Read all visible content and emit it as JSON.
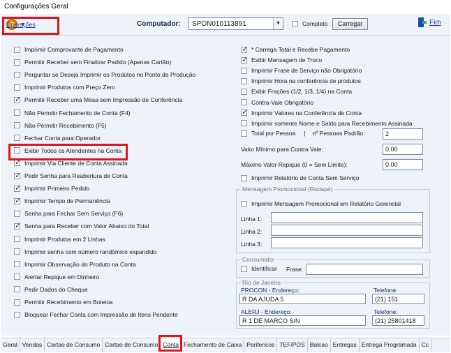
{
  "window": {
    "title": "Configurações Geral"
  },
  "toolbar": {
    "operations_label": "Operações",
    "computer_label": "Computador:",
    "computer_value": "SPON010113891",
    "complete_label": "Completo",
    "load_label": "Carregar",
    "exit_label": "Fim"
  },
  "left_options": [
    {
      "label": "Imprimir Comprovante de Pagamento",
      "checked": false
    },
    {
      "label": "Permitir Receber sem Finalizar Pedido (Apenas Cartão)",
      "checked": false
    },
    {
      "label": "Perguntar se Deseja Imprimir os Produtos no Ponto de Produção",
      "checked": false
    },
    {
      "label": "Imprimir Produtos com Preço Zero",
      "checked": false
    },
    {
      "label": "Permitir Receber uma Mesa sem Impressão de Conferência",
      "checked": true
    },
    {
      "label": "Não Permitir Fechamento de Conta (F4)",
      "checked": false
    },
    {
      "label": "Não Permitir Recebimento (F5)",
      "checked": false
    },
    {
      "label": "Fechar Conta para Operador",
      "checked": false
    },
    {
      "label": "Exibir Todos os Atendentes na Conta",
      "checked": false
    },
    {
      "label": "Imprimir Via Cliente de Conta Assinada",
      "checked": true
    },
    {
      "label": "Pedir Senha para Reabertura de Conta",
      "checked": true
    },
    {
      "label": "Imprimir Primeiro Pedido",
      "checked": true
    },
    {
      "label": "Imprimir Tempo de Permanência",
      "checked": true
    },
    {
      "label": "Senha para Fechar Sem Serviço (F6)",
      "checked": false
    },
    {
      "label": "Senha para Receber com Valor Abaixo do Total",
      "checked": true
    },
    {
      "label": "Imprimir Produtos em 2 Linhas",
      "checked": false
    },
    {
      "label": "Imprimir senha com número randômico expandido",
      "checked": false
    },
    {
      "label": "Imprimir Observação do Produto na Conta",
      "checked": false
    },
    {
      "label": "Alertar Repique em Dinheiro",
      "checked": false
    },
    {
      "label": "Pedir Dados do Cheque",
      "checked": false
    },
    {
      "label": "Permitir Recebimento em Boletos",
      "checked": false
    },
    {
      "label": "Bloquear Fechar Conta com Impressão de Itens Pendente",
      "checked": false
    }
  ],
  "right_options": [
    {
      "label": "* Carrega Total e Recebe Pagamento",
      "checked": true
    },
    {
      "label": "Exibir Mensagem de Troco",
      "checked": true
    },
    {
      "label": "Imprimir Frase de Serviço não Obrigatório",
      "checked": false
    },
    {
      "label": "Imprimir Hora na conferência de produtos",
      "checked": false
    },
    {
      "label": "Exibir Frações (1/2, 1/3, 1/4) na Conta",
      "checked": false
    },
    {
      "label": "Contra-Vale Obrigatório",
      "checked": false
    },
    {
      "label": "Imprimir Valores na Conferência de Conta",
      "checked": true
    },
    {
      "label": "Imprimir somente Nome e Saldo para Recebimento Assinada",
      "checked": false
    }
  ],
  "total_pessoa": {
    "label": "Total por Pessoa",
    "sep": "|",
    "count_label": "nº Pessoas Padrão:",
    "count_value": "2",
    "checked": false
  },
  "min_voucher": {
    "label": "Valor Mínimo para Contra Vale:",
    "value": "0.00"
  },
  "max_tip": {
    "label": "Máximo Valor Repique (0 = Sem Limite):",
    "value": "0.00"
  },
  "print_report": {
    "label": "Imprimir Relatório de Conta Sem Serviço",
    "checked": false
  },
  "promo": {
    "title": "Mensagem Promocional (Rodapé)",
    "print_label": "Imprimir Mensagem Promocional em Relatório Gerencial",
    "print_checked": false,
    "line1_label": "Linha 1:",
    "line1_value": "",
    "line2_label": "Linha 2:",
    "line2_value": "",
    "line3_label": "Linha 3:",
    "line3_value": ""
  },
  "consumer": {
    "title": "Consumidor",
    "identify_label": "Identificar",
    "identify_checked": false,
    "phrase_label": "Frase:",
    "phrase_value": ""
  },
  "rj": {
    "title": "Rio de Janeiro",
    "procon_label": "PROCON - Endereço:",
    "procon_value": "R DA AJUDA 5",
    "procon_phone_label": "Telefone:",
    "procon_phone_value": "(21) 151",
    "alerj_label": "ALERJ - Endereço:",
    "alerj_value": "R 1 DE MARCO S/N",
    "alerj_phone_label": "Telefone:",
    "alerj_phone_value": "(21) 25801418"
  },
  "tabs": [
    "Geral",
    "Vendas",
    "Cartao de Consumo",
    "Cartao de Consumo",
    "Conta",
    "Fechamento de Caixa",
    "Perifericos",
    "TEF/POS",
    "Balcao",
    "Entregas",
    "Entrega Programada",
    "Cc"
  ],
  "active_tab": "Conta"
}
